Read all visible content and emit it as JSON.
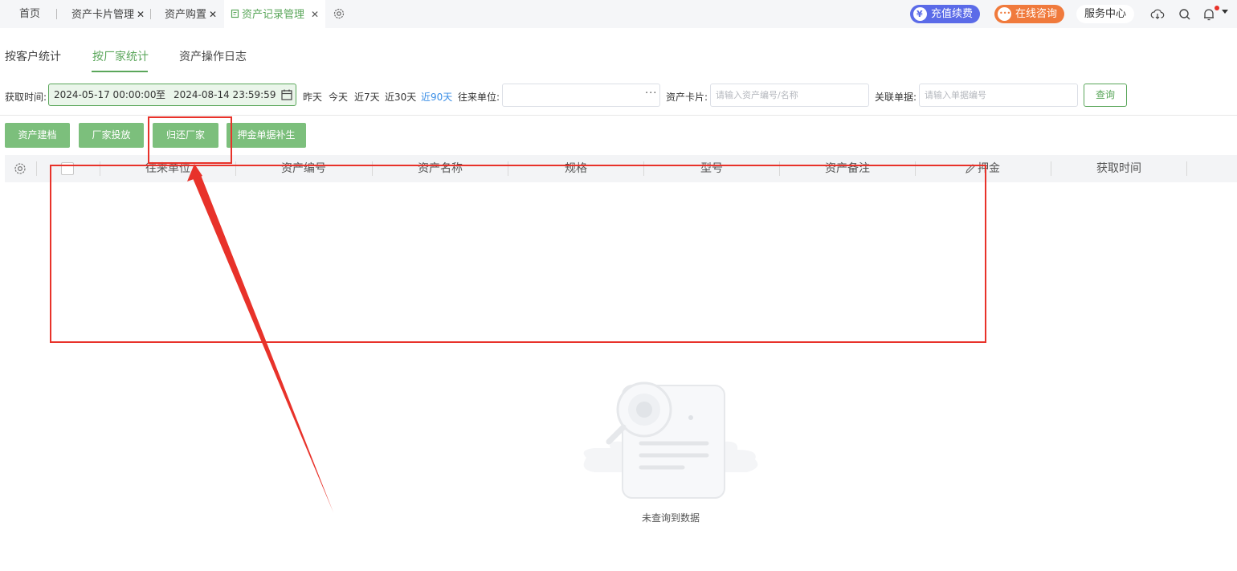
{
  "tabs": [
    {
      "label": "首页"
    },
    {
      "label": "资产卡片管理"
    },
    {
      "label": "资产购置"
    },
    {
      "label": "资产记录管理"
    }
  ],
  "tab_close": "✕",
  "header": {
    "renew_label": "充值续费",
    "consult_label": "在线咨询",
    "service_label": "服务中心"
  },
  "subtabs": [
    "按客户统计",
    "按厂家统计",
    "资产操作日志"
  ],
  "filters": {
    "time_label": "获取时间:",
    "date_start": "2024-05-17 00:00:00",
    "date_to": "至",
    "date_end": "2024-08-14 23:59:59",
    "quick": [
      "昨天",
      "今天",
      "近7天",
      "近30天",
      "近90天"
    ],
    "partner_label": "往来单位:",
    "partner_value": "",
    "card_label": "资产卡片:",
    "card_placeholder": "请输入资产编号/名称",
    "bill_label": "关联单据:",
    "bill_placeholder": "请输入单据编号",
    "query_label": "查询"
  },
  "actions": [
    "资产建档",
    "厂家投放",
    "归还厂家",
    "押金单据补生"
  ],
  "table": {
    "columns": [
      "往来单位",
      "资产编号",
      "资产名称",
      "规格",
      "型号",
      "资产备注",
      "押金",
      "获取时间"
    ]
  },
  "empty_text": "未查询到数据",
  "colors": {
    "accent": "#5aa65a",
    "button_fill": "#7cbf7c",
    "link": "#3a8ee6",
    "annotation": "#e8322a",
    "renew": "#5b6be8",
    "consult": "#f07a3c"
  }
}
